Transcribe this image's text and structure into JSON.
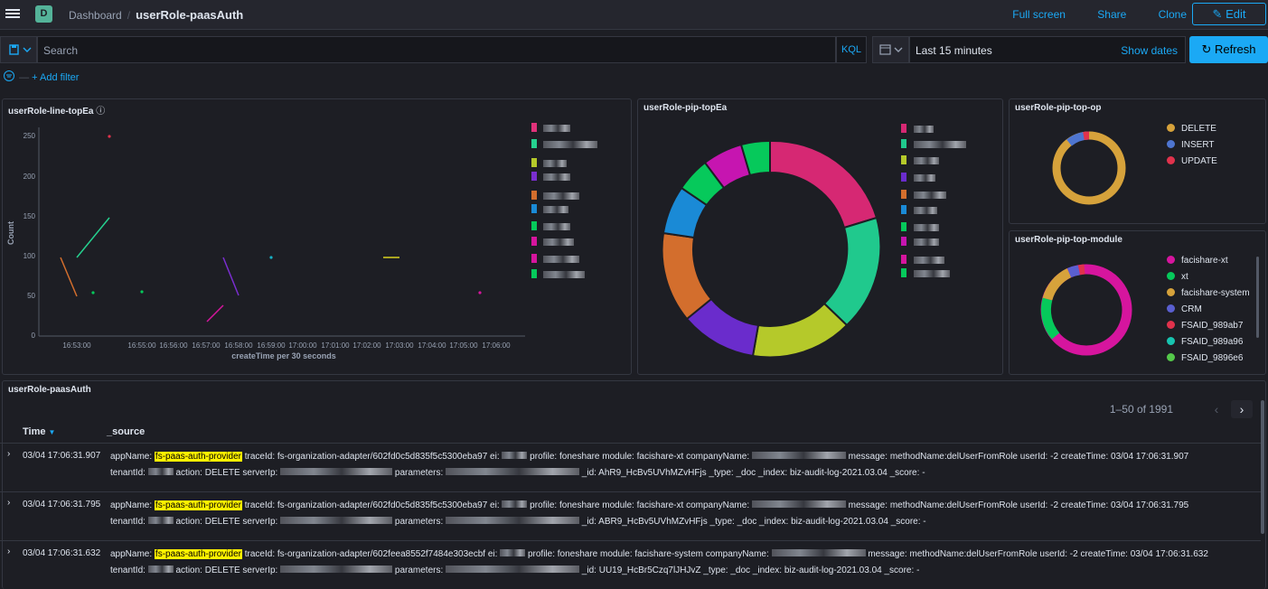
{
  "header": {
    "app_badge": "D",
    "breadcrumb_root": "Dashboard",
    "breadcrumb_sep": "/",
    "title": "userRole-paasAuth",
    "links": [
      "Full screen",
      "Share",
      "Clone"
    ],
    "edit_label": "Edit"
  },
  "query": {
    "placeholder": "Search",
    "language": "KQL",
    "time_range": "Last 15 minutes",
    "show_dates": "Show dates",
    "refresh_label": "Refresh",
    "add_filter": "+ Add filter"
  },
  "panels": {
    "line": {
      "title": "userRole-line-topEa",
      "ylabel": "Count",
      "xlabel": "createTime per 30 seconds",
      "yticks": [
        "250",
        "200",
        "150",
        "100",
        "50",
        "0"
      ],
      "xticks": [
        "16:53:00",
        "16:55:00",
        "16:56:00",
        "16:57:00",
        "16:58:00",
        "16:59:00",
        "17:00:00",
        "17:01:00",
        "17:02:00",
        "17:03:00",
        "17:04:00",
        "17:05:00",
        "17:06:00"
      ]
    },
    "pie_ea": {
      "title": "userRole-pip-topEa"
    },
    "pie_op": {
      "title": "userRole-pip-top-op",
      "legend": [
        "DELETE",
        "INSERT",
        "UPDATE"
      ]
    },
    "pie_module": {
      "title": "userRole-pip-top-module",
      "legend": [
        "facishare-xt",
        "xt",
        "facishare-system",
        "CRM",
        "FSAID_989ab7",
        "FSAID_989a96",
        "FSAID_9896e6"
      ]
    }
  },
  "colors": {
    "DELETE": "#d6a23b",
    "INSERT": "#4e75d0",
    "UPDATE": "#e0324c",
    "facishare-xt": "#d6159e",
    "xt": "#06c95b",
    "facishare-system": "#d6a23b",
    "CRM": "#5a5fd0",
    "FSAID_989ab7": "#e0324c",
    "FSAID_989a96": "#17c4b0",
    "FSAID_9896e6": "#54c94a"
  },
  "table": {
    "title": "userRole-paasAuth",
    "pagination": "1–50 of 1991",
    "col_time": "Time",
    "col_source": "_source",
    "rows": [
      {
        "time": "03/04 17:06:31.907",
        "app": "fs-paas-auth-provider",
        "traceId": "fs-organization-adapter/602fd0c5d835f5c5300eba97",
        "profile": "foneshare",
        "module": "facishare-xt",
        "message": "methodName:delUserFromRole",
        "userId": "-2",
        "createTime": "03/04 17:06:31.907",
        "action": "DELETE",
        "_id": "AhR9_HcBv5UVhMZvHFjs",
        "_type": "_doc",
        "_index": "biz-audit-log-2021.03.04",
        "_score": "-"
      },
      {
        "time": "03/04 17:06:31.795",
        "app": "fs-paas-auth-provider",
        "traceId": "fs-organization-adapter/602fd0c5d835f5c5300eba97",
        "profile": "foneshare",
        "module": "facishare-xt",
        "message": "methodName:delUserFromRole",
        "userId": "-2",
        "createTime": "03/04 17:06:31.795",
        "action": "DELETE",
        "_id": "ABR9_HcBv5UVhMZvHFjs",
        "_type": "_doc",
        "_index": "biz-audit-log-2021.03.04",
        "_score": "-"
      },
      {
        "time": "03/04 17:06:31.632",
        "app": "fs-paas-auth-provider",
        "traceId": "fs-organization-adapter/602feea8552f7484e303ecbf",
        "profile": "foneshare",
        "module": "facishare-system",
        "message": "methodName:delUserFromRole",
        "userId": "-2",
        "createTime": "03/04 17:06:31.632",
        "action": "DELETE",
        "_id": "UU19_HcBr5Czq7lJHJvZ",
        "_type": "_doc",
        "_index": "biz-audit-log-2021.03.04",
        "_score": "-"
      }
    ]
  }
}
